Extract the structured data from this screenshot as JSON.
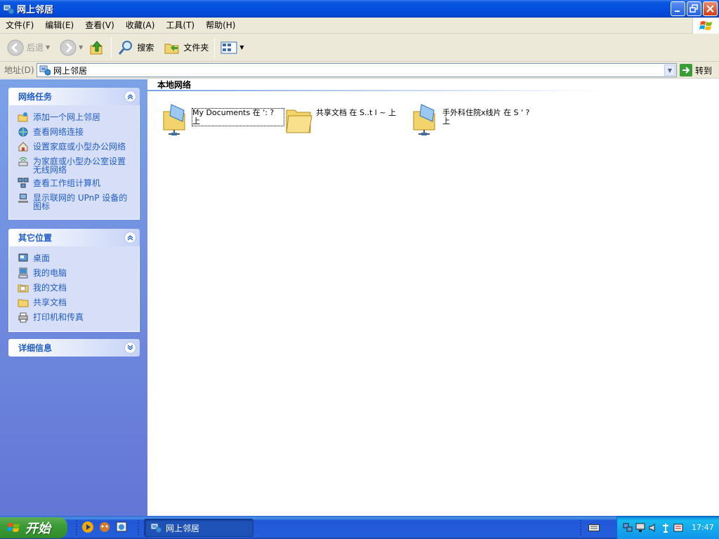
{
  "window": {
    "title": "网上邻居",
    "controls": {
      "minimize": "minimize",
      "restore": "restore",
      "close": "close"
    }
  },
  "menu": {
    "items": [
      "文件(F)",
      "编辑(E)",
      "查看(V)",
      "收藏(A)",
      "工具(T)",
      "帮助(H)"
    ]
  },
  "toolbar": {
    "back_label": "后退",
    "search_label": "搜索",
    "folders_label": "文件夹"
  },
  "address": {
    "label": "地址(D)",
    "value": "网上邻居",
    "go_label": "转到"
  },
  "sidebar": {
    "network_tasks": {
      "title": "网络任务",
      "items": [
        {
          "label": "添加一个网上邻居",
          "icon": "add-network-place-icon"
        },
        {
          "label": "查看网络连接",
          "icon": "network-connections-icon"
        },
        {
          "label": "设置家庭或小型办公网络",
          "icon": "home-network-icon"
        },
        {
          "label": "为家庭或小型办公室设置无线网络",
          "icon": "wireless-network-icon"
        },
        {
          "label": "查看工作组计算机",
          "icon": "workgroup-icon"
        },
        {
          "label": "显示联网的 UPnP 设备的图标",
          "icon": "upnp-device-icon"
        }
      ]
    },
    "other_places": {
      "title": "其它位置",
      "items": [
        {
          "label": "桌面",
          "icon": "desktop-icon"
        },
        {
          "label": "我的电脑",
          "icon": "my-computer-icon"
        },
        {
          "label": "我的文档",
          "icon": "my-documents-icon"
        },
        {
          "label": "共享文档",
          "icon": "shared-documents-icon"
        },
        {
          "label": "打印机和传真",
          "icon": "printers-icon"
        }
      ]
    },
    "details": {
      "title": "详细信息"
    }
  },
  "content": {
    "group_header": "本地网络",
    "items": [
      {
        "label": "My Documents 在 ': ? 上",
        "icon": "network-share-icon",
        "selected": true
      },
      {
        "label": "共享文档 在 S..t l ~ 上",
        "icon": "folder-icon",
        "selected": false
      },
      {
        "label": "手外科住院x线片 在 S ' ? 上",
        "icon": "network-share-icon",
        "selected": false
      }
    ]
  },
  "taskbar": {
    "start_label": "开始",
    "task_button_label": "网上邻居",
    "clock": "17:47"
  },
  "colors": {
    "titlebar": "#0550e0",
    "sidebar_top": "#7ba2e7",
    "sidebar_bottom": "#6375d6",
    "task_link": "#215dc6",
    "start_green": "#3c9c36",
    "tray_blue": "#18b9f1"
  }
}
